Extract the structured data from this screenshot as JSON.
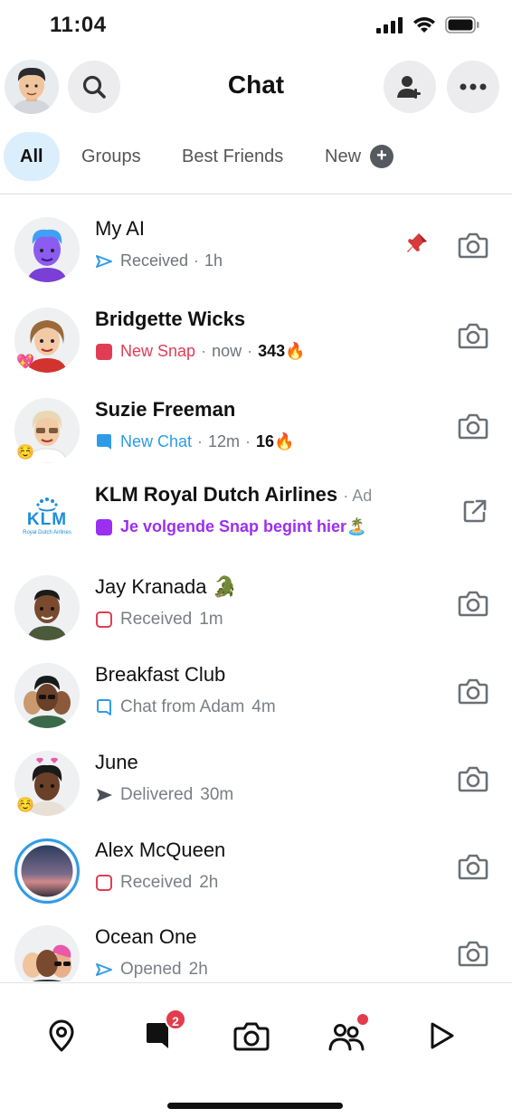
{
  "status": {
    "time": "11:04"
  },
  "header": {
    "title": "Chat"
  },
  "tabs": [
    {
      "label": "All",
      "active": true
    },
    {
      "label": "Groups"
    },
    {
      "label": "Best Friends"
    },
    {
      "label": "New"
    }
  ],
  "chats": [
    {
      "name": "My AI",
      "status": "Received",
      "time": "1h",
      "pinned": true,
      "action_icon": "camera-icon"
    },
    {
      "name": "Bridgette Wicks",
      "status": "New Snap",
      "time": "now",
      "streak": "343",
      "streak_emoji": "🔥",
      "friend_emoji": "💖",
      "action_icon": "camera-icon"
    },
    {
      "name": "Suzie Freeman",
      "status": "New Chat",
      "time": "12m",
      "streak": "16",
      "streak_emoji": "🔥",
      "friend_emoji": "☺️",
      "action_icon": "camera-icon"
    },
    {
      "name": "KLM Royal Dutch Airlines",
      "ad_label": "Ad",
      "status": "Je volgende Snap begint hier",
      "status_emoji": "🏝️",
      "logo_text": "KLM",
      "logo_sub": "Royal Dutch Airlines",
      "action_icon": "external-link-icon"
    },
    {
      "name": "Jay Kranada",
      "name_emoji": "🐊",
      "status": "Received",
      "time": "1m",
      "action_icon": "camera-icon"
    },
    {
      "name": "Breakfast Club",
      "status": "Chat from Adam",
      "time": "4m",
      "action_icon": "camera-icon"
    },
    {
      "name": "June",
      "status": "Delivered",
      "time": "30m",
      "friend_emoji": "☺️",
      "action_icon": "camera-icon"
    },
    {
      "name": "Alex McQueen",
      "status": "Received",
      "time": "2h",
      "action_icon": "camera-icon"
    },
    {
      "name": "Ocean One",
      "status": "Opened",
      "time": "2h",
      "action_icon": "camera-icon"
    }
  ],
  "bottom_nav": [
    {
      "icon": "map-pin-icon"
    },
    {
      "icon": "chat-icon",
      "badge": "2"
    },
    {
      "icon": "camera-icon"
    },
    {
      "icon": "friends-icon",
      "dot": true
    },
    {
      "icon": "play-icon"
    }
  ],
  "colors": {
    "accent_blue": "#2f9be6",
    "snap_red": "#e23c55",
    "ad_purple": "#9b2ff0",
    "tab_active_bg": "#dbeefc"
  }
}
